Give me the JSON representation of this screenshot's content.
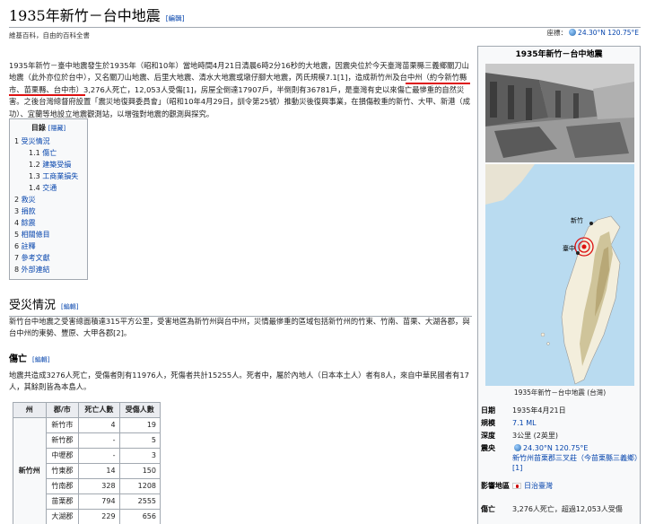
{
  "page": {
    "title": "1935年新竹－台中地震",
    "title_edit": "[編輯]",
    "from": "維基百科，自由的百科全書",
    "coord_label": "座標：",
    "coord_value": "24.30°N 120.75°E"
  },
  "intro": {
    "text": "1935年新竹－臺中地震發生於1935年（昭和10年）當地時間4月21日清晨6時2分16秒的大地震，因震央位於今天臺灣苗栗縣三義鄉關刀山地震（此外亦位於台中），又名關刀山地震、后里大地震、清水大地震或墩仔腳大地震，芮氏規模7.1[1]，造成新竹州及台中州（約今新竹縣市、苗栗縣、台中市）3,276人死亡，12,053人受傷[1]，房屋全倒達17907戶，半倒則有36781戶，是臺灣有史以來傷亡最慘重的自然災害。之後台灣總督府設置「震災地復興委員會」（昭和10年4月29日，訓令第25號）推動災後復興事業，在損傷較重的新竹、大甲、新港（成功）、宜蘭等地設立地震觀測站，以增強對地震的觀測與探究。"
  },
  "toc": {
    "title": "目錄",
    "toggle": "[隱藏]",
    "items": [
      {
        "num": "1",
        "label": "受災情況"
      },
      {
        "num": "1.1",
        "label": "傷亡"
      },
      {
        "num": "1.2",
        "label": "建築受損"
      },
      {
        "num": "1.3",
        "label": "工商業損失"
      },
      {
        "num": "1.4",
        "label": "交通"
      },
      {
        "num": "2",
        "label": "救災"
      },
      {
        "num": "3",
        "label": "捐款"
      },
      {
        "num": "4",
        "label": "餘震"
      },
      {
        "num": "5",
        "label": "相關條目"
      },
      {
        "num": "6",
        "label": "註釋"
      },
      {
        "num": "7",
        "label": "參考文獻"
      },
      {
        "num": "8",
        "label": "外部連結"
      }
    ]
  },
  "section1": {
    "heading": "受災情況",
    "edit": "[編輯]",
    "text": "新竹台中地震之受害總面積達315平方公里，受害地區為新竹州與台中州，災情最慘重的區域包括新竹州的竹東、竹南、苗栗、大湖各郡，與台中州的東勢、豐原、大甲各郡[2]。"
  },
  "section1_1": {
    "heading": "傷亡",
    "edit": "[編輯]",
    "text": "地震共造成3276人死亡，受傷者則有11976人，死傷者共計15255人。死者中，屬於內地人（日本本土人）者有8人，來自中華民國者有17人，其餘則皆為本島人。"
  },
  "casualty_table": {
    "headers": [
      "州",
      "郡/市",
      "死亡人數",
      "受傷人數"
    ],
    "state": "新竹州",
    "rows": [
      [
        "新竹市",
        "4",
        "19"
      ],
      [
        "新竹郡",
        "-",
        "5"
      ],
      [
        "中壢郡",
        "-",
        "3"
      ],
      [
        "竹東郡",
        "14",
        "150"
      ],
      [
        "竹南郡",
        "328",
        "1208"
      ],
      [
        "苗栗郡",
        "794",
        "2555"
      ],
      [
        "大湖郡",
        "229",
        "656"
      ]
    ]
  },
  "infobox": {
    "title": "1935年新竹－台中地震",
    "map_caption": "1935年新竹－台中地震 (台灣)",
    "map_label_hsinchu": "新竹",
    "map_label_taichung": "臺中",
    "rows": [
      {
        "key": "日期",
        "value": "1935年4月21日"
      },
      {
        "key": "規模",
        "value": "7.1 ML"
      },
      {
        "key": "深度",
        "value": "3公里 (2英里)"
      },
      {
        "key": "震央",
        "value": "24.30°N 120.75°E"
      },
      {
        "key": "震央2",
        "value": "新竹州苗栗郡三叉莊（今苗栗縣三義鄉）[1]"
      },
      {
        "key": "影響地區",
        "value": "日治臺灣"
      },
      {
        "key": "傷亡",
        "value": "3,276人死亡，超過12,053人受傷"
      }
    ]
  },
  "colors": {
    "link": "#0645ad",
    "annotation_red": "#dd1111",
    "border": "#a2a9b1"
  }
}
